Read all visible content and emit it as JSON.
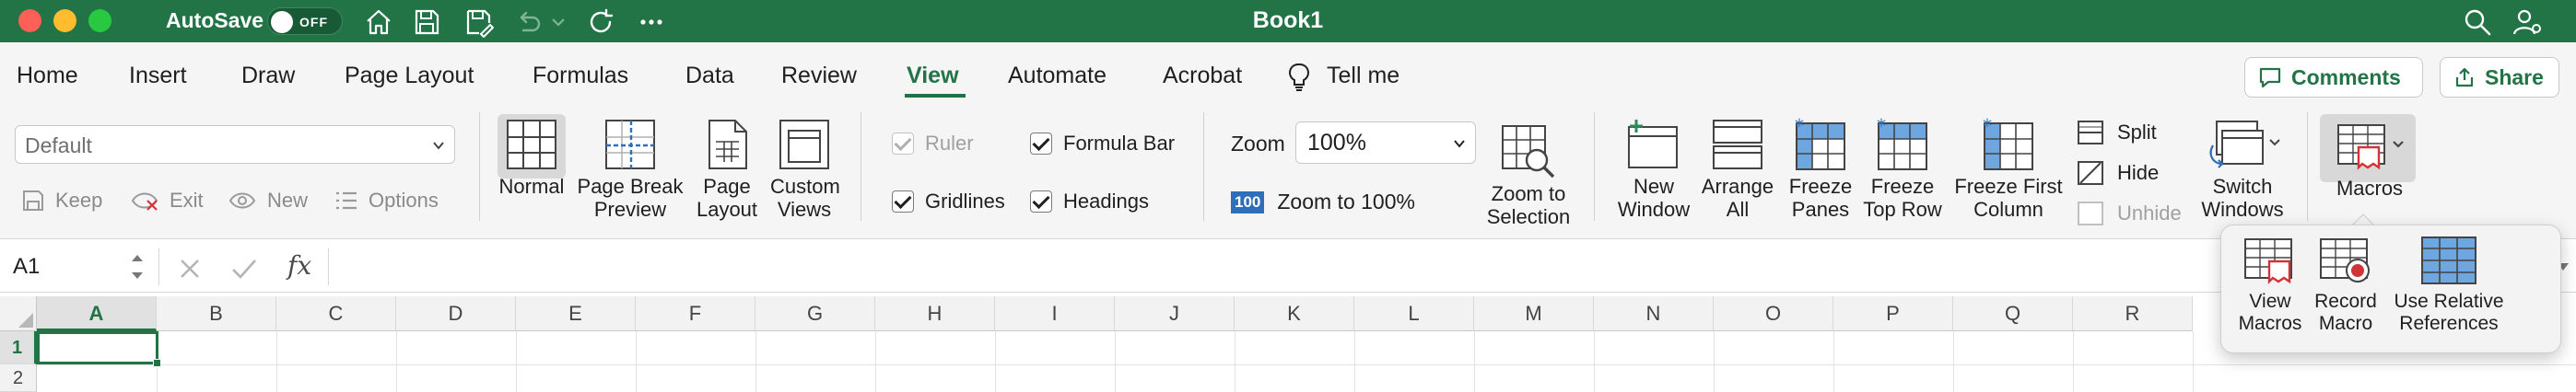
{
  "window": {
    "title": "Book1",
    "autosave_label": "AutoSave",
    "autosave_state": "OFF"
  },
  "colors": {
    "accent": "#227447",
    "macro_red": "#d13438",
    "pane_blue": "#2f6fba"
  },
  "quick_access_icons": [
    "home-icon",
    "save-icon",
    "save-as-icon",
    "undo-icon",
    "redo-icon",
    "more-icon"
  ],
  "menu": {
    "tabs": [
      "Home",
      "Insert",
      "Draw",
      "Page Layout",
      "Formulas",
      "Data",
      "Review",
      "View",
      "Automate",
      "Acrobat"
    ],
    "active_tab": "View",
    "tell_me": "Tell me",
    "comments_label": "Comments",
    "share_label": "Share"
  },
  "ribbon": {
    "sheet_view": {
      "selected": "Default",
      "keep": "Keep",
      "exit": "Exit",
      "new": "New",
      "options": "Options"
    },
    "workbook_views": {
      "normal": "Normal",
      "page_break_line1": "Page Break",
      "page_break_line2": "Preview",
      "page_layout_line1": "Page",
      "page_layout_line2": "Layout",
      "custom_line1": "Custom",
      "custom_line2": "Views"
    },
    "show": {
      "ruler": "Ruler",
      "formula_bar": "Formula Bar",
      "gridlines": "Gridlines",
      "headings": "Headings"
    },
    "zoom": {
      "label": "Zoom",
      "value": "100%",
      "badge": "100",
      "zoom100_label": "Zoom to 100%",
      "zoom_sel_line1": "Zoom to",
      "zoom_sel_line2": "Selection"
    },
    "window": {
      "new_line1": "New",
      "new_line2": "Window",
      "arrange_line1": "Arrange",
      "arrange_line2": "All",
      "freeze_line1": "Freeze",
      "freeze_line2": "Panes",
      "freeze_top_line1": "Freeze",
      "freeze_top_line2": "Top Row",
      "freeze_first_line1": "Freeze First",
      "freeze_first_line2": "Column",
      "split": "Split",
      "hide": "Hide",
      "unhide": "Unhide",
      "switch_line1": "Switch",
      "switch_line2": "Windows"
    },
    "macros": "Macros"
  },
  "formula_bar": {
    "name_box": "A1",
    "fx": "fx",
    "content": ""
  },
  "grid": {
    "columns": [
      "A",
      "B",
      "C",
      "D",
      "E",
      "F",
      "G",
      "H",
      "I",
      "J",
      "K",
      "L",
      "M",
      "N",
      "O",
      "P",
      "Q",
      "R"
    ],
    "rows": [
      "1",
      "2"
    ],
    "active_cell": "A1"
  },
  "macros_menu": {
    "view_line1": "View",
    "view_line2": "Macros",
    "record_line1": "Record",
    "record_line2": "Macro",
    "relative_line1": "Use Relative",
    "relative_line2": "References"
  }
}
